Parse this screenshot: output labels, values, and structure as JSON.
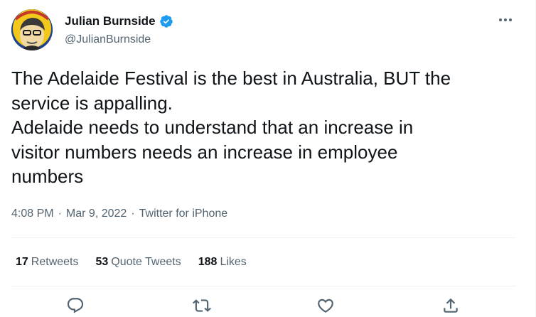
{
  "author": {
    "name": "Julian Burnside",
    "handle": "@JulianBurnside",
    "verified": true,
    "avatar": "avatar-portrait"
  },
  "tweet": {
    "lines": [
      "The Adelaide Festival is the best in Australia, BUT the",
      "service is appalling.",
      "Adelaide needs to understand that an increase in",
      "visitor numbers needs an increase in employee",
      "numbers"
    ],
    "time": "4:08 PM",
    "date": "Mar 9, 2022",
    "source": "Twitter for iPhone",
    "separator": "·"
  },
  "stats": {
    "retweets_count": "17",
    "retweets_label": "Retweets",
    "quotes_count": "53",
    "quotes_label": "Quote Tweets",
    "likes_count": "188",
    "likes_label": "Likes"
  },
  "actions": [
    "reply-icon",
    "retweet-icon",
    "like-icon",
    "share-icon"
  ],
  "colors": {
    "text": "#0f1419",
    "secondary": "#536471",
    "verified": "#1d9bf0",
    "border": "#eff3f4"
  }
}
